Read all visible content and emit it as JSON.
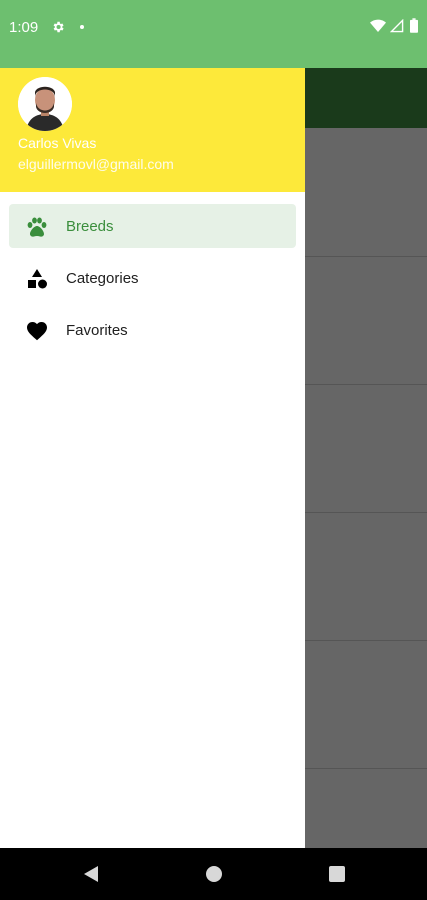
{
  "status_bar": {
    "time": "1:09",
    "icons": [
      "gear-icon",
      "notification-dot",
      "wifi-icon",
      "signal-icon",
      "battery-icon"
    ]
  },
  "drawer": {
    "user": {
      "name": "Carlos Vivas",
      "email": "elguillermovl@gmail.com"
    },
    "items": [
      {
        "label": "Breeds",
        "icon": "paw-icon",
        "active": true
      },
      {
        "label": "Categories",
        "icon": "shapes-icon",
        "active": false
      },
      {
        "label": "Favorites",
        "icon": "heart-icon",
        "active": false
      }
    ]
  },
  "colors": {
    "status_bar": "#6dbf6f",
    "header": "#fde93a",
    "accent": "#3a8e3c",
    "active_bg": "#e6f1e6"
  },
  "nav_bar": {
    "buttons": [
      "back-icon",
      "home-icon",
      "recents-icon"
    ]
  }
}
